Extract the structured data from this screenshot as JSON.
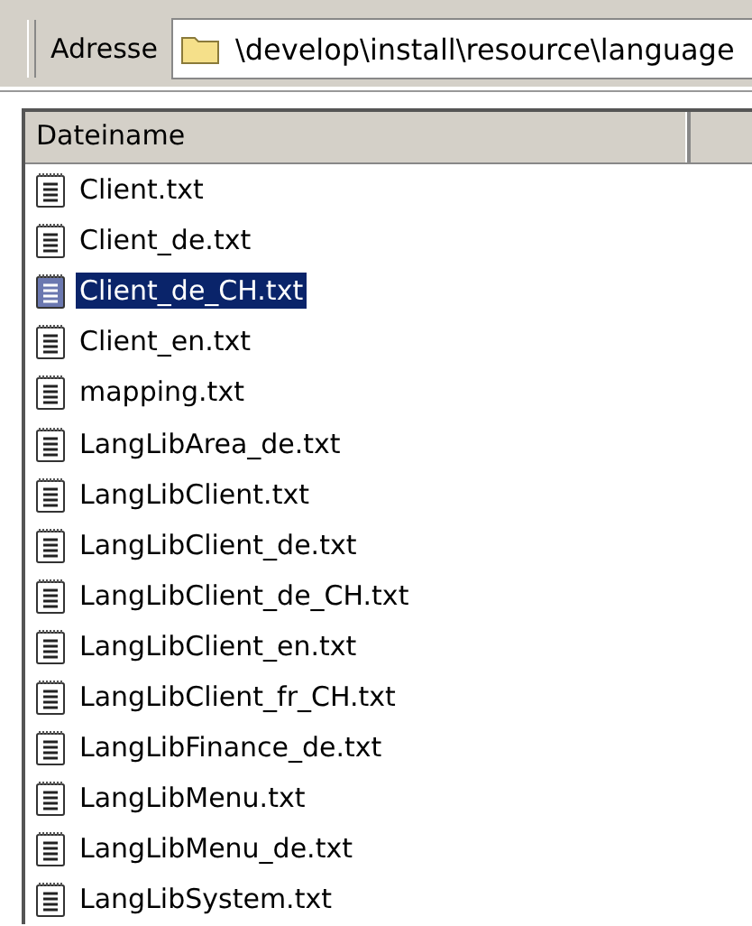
{
  "address_bar": {
    "label": "Adresse",
    "path": "\\develop\\install\\resource\\language"
  },
  "table": {
    "columns": [
      "Dateiname"
    ],
    "rows": [
      {
        "name": "Client.txt",
        "selected": false
      },
      {
        "name": "Client_de.txt",
        "selected": false
      },
      {
        "name": "Client_de_CH.txt",
        "selected": true
      },
      {
        "name": "Client_en.txt",
        "selected": false
      },
      {
        "name": "mapping.txt",
        "selected": false
      },
      {
        "name": "LangLibArea_de.txt",
        "selected": false
      },
      {
        "name": "LangLibClient.txt",
        "selected": false
      },
      {
        "name": "LangLibClient_de.txt",
        "selected": false
      },
      {
        "name": "LangLibClient_de_CH.txt",
        "selected": false
      },
      {
        "name": "LangLibClient_en.txt",
        "selected": false
      },
      {
        "name": "LangLibClient_fr_CH.txt",
        "selected": false
      },
      {
        "name": "LangLibFinance_de.txt",
        "selected": false
      },
      {
        "name": "LangLibMenu.txt",
        "selected": false
      },
      {
        "name": "LangLibMenu_de.txt",
        "selected": false
      },
      {
        "name": "LangLibSystem.txt",
        "selected": false
      }
    ]
  }
}
